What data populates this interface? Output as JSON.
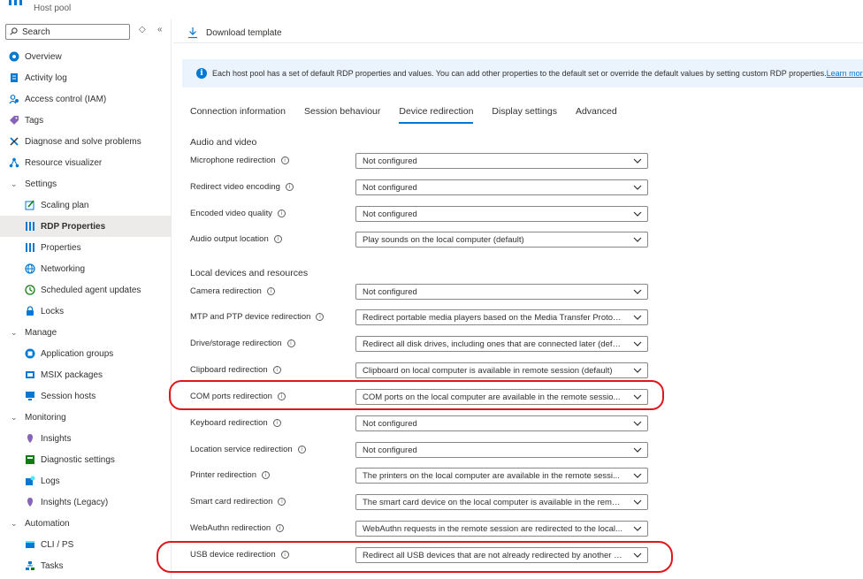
{
  "header": {
    "resource_type": "Host pool"
  },
  "sidebar": {
    "search_placeholder": "Search",
    "items": [
      {
        "label": "Overview",
        "level": 0,
        "icon": "overview-icon",
        "color": "#0078d4"
      },
      {
        "label": "Activity log",
        "level": 0,
        "icon": "activity-log-icon",
        "color": "#0078d4"
      },
      {
        "label": "Access control (IAM)",
        "level": 0,
        "icon": "iam-icon",
        "color": "#0078d4"
      },
      {
        "label": "Tags",
        "level": 0,
        "icon": "tag-icon",
        "color": "#8764b8"
      },
      {
        "label": "Diagnose and solve problems",
        "level": 0,
        "icon": "wrench-icon",
        "color": "#0078d4"
      },
      {
        "label": "Resource visualizer",
        "level": 0,
        "icon": "visualizer-icon",
        "color": "#0078d4"
      },
      {
        "label": "Settings",
        "level": "group"
      },
      {
        "label": "Scaling plan",
        "level": 1,
        "icon": "scaling-plan-icon",
        "color": "#0078d4"
      },
      {
        "label": "RDP Properties",
        "level": 1,
        "icon": "rdp-properties-icon",
        "color": "#0078d4",
        "active": true
      },
      {
        "label": "Properties",
        "level": 1,
        "icon": "properties-icon",
        "color": "#0078d4"
      },
      {
        "label": "Networking",
        "level": 1,
        "icon": "networking-icon",
        "color": "#0078d4"
      },
      {
        "label": "Scheduled agent updates",
        "level": 1,
        "icon": "clock-icon",
        "color": "#107c10"
      },
      {
        "label": "Locks",
        "level": 1,
        "icon": "lock-icon",
        "color": "#0078d4"
      },
      {
        "label": "Manage",
        "level": "group"
      },
      {
        "label": "Application groups",
        "level": 1,
        "icon": "application-groups-icon",
        "color": "#0078d4"
      },
      {
        "label": "MSIX packages",
        "level": 1,
        "icon": "msix-icon",
        "color": "#0078d4"
      },
      {
        "label": "Session hosts",
        "level": 1,
        "icon": "session-hosts-icon",
        "color": "#0078d4"
      },
      {
        "label": "Monitoring",
        "level": "group"
      },
      {
        "label": "Insights",
        "level": 1,
        "icon": "insights-icon",
        "color": "#8764b8"
      },
      {
        "label": "Diagnostic settings",
        "level": 1,
        "icon": "diagnostic-settings-icon",
        "color": "#107c10"
      },
      {
        "label": "Logs",
        "level": 1,
        "icon": "logs-icon",
        "color": "#0078d4"
      },
      {
        "label": "Insights (Legacy)",
        "level": 1,
        "icon": "insights-legacy-icon",
        "color": "#8764b8"
      },
      {
        "label": "Automation",
        "level": "group"
      },
      {
        "label": "CLI / PS",
        "level": 1,
        "icon": "cli-icon",
        "color": "#0078d4"
      },
      {
        "label": "Tasks",
        "level": 1,
        "icon": "tasks-icon",
        "color": "#0078d4"
      }
    ]
  },
  "toolbar": {
    "download_label": "Download template"
  },
  "info": {
    "text": "Each host pool has a set of default RDP properties and values. You can add other properties to the default set or override the default values by setting custom RDP properties.",
    "link": "Learn more"
  },
  "tabs": [
    {
      "label": "Connection information",
      "active": false
    },
    {
      "label": "Session behaviour",
      "active": false
    },
    {
      "label": "Device redirection",
      "active": true
    },
    {
      "label": "Display settings",
      "active": false
    },
    {
      "label": "Advanced",
      "active": false
    }
  ],
  "sections": {
    "audio_video": "Audio and video",
    "local_devices": "Local devices and resources"
  },
  "fields": [
    {
      "label": "Microphone redirection",
      "value": "Not configured"
    },
    {
      "label": "Redirect video encoding",
      "value": "Not configured"
    },
    {
      "label": "Encoded video quality",
      "value": "Not configured"
    },
    {
      "label": "Audio output location",
      "value": "Play sounds on the local computer (default)"
    },
    {
      "label": "Camera redirection",
      "value": "Not configured"
    },
    {
      "label": "MTP and PTP device redirection",
      "value": "Redirect portable media players based on the Media Transfer Protoc..."
    },
    {
      "label": "Drive/storage redirection",
      "value": "Redirect all disk drives, including ones that are connected later (defa..."
    },
    {
      "label": "Clipboard redirection",
      "value": "Clipboard on local computer is available in remote session (default)"
    },
    {
      "label": "COM ports redirection",
      "value": "COM ports on the local computer are available in the remote sessio..."
    },
    {
      "label": "Keyboard redirection",
      "value": "Not configured"
    },
    {
      "label": "Location service redirection",
      "value": "Not configured"
    },
    {
      "label": "Printer redirection",
      "value": "The printers on the local computer are available in the remote sessi..."
    },
    {
      "label": "Smart card redirection",
      "value": "The smart card device on the local computer is available in the remo..."
    },
    {
      "label": "WebAuthn redirection",
      "value": "WebAuthn requests in the remote session are redirected to the local..."
    },
    {
      "label": "USB device redirection",
      "value": "Redirect all USB devices that are not already redirected by another h..."
    }
  ],
  "colors": {
    "accent": "#0078d4",
    "annotation": "#e0161c",
    "info_bar": "#ebf3fc"
  }
}
